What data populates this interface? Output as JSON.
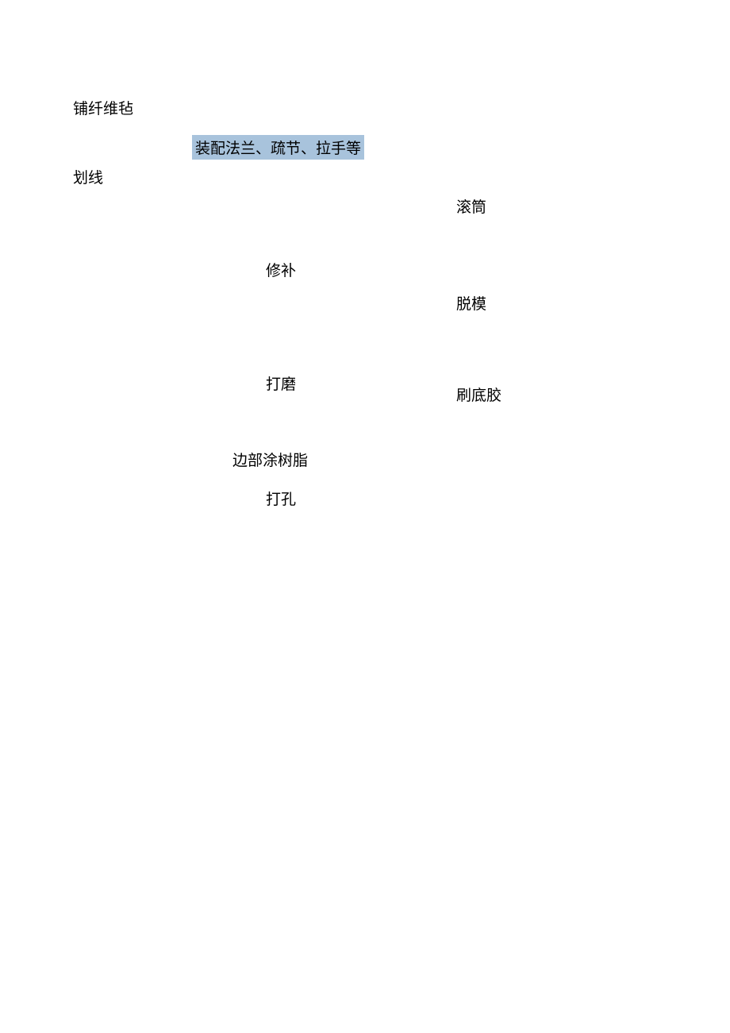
{
  "labels": {
    "puFiberMat": "铺纤维毡",
    "assemblyFlange": "装配法兰、疏节、拉手等",
    "huaLine": "划线",
    "roller": "滚筒",
    "repair": "修补",
    "demold": "脱模",
    "polish": "打磨",
    "brushPrimer": "刷底胶",
    "edgeCoatResin": "边部涂树脂",
    "drillHole": "打孔"
  }
}
